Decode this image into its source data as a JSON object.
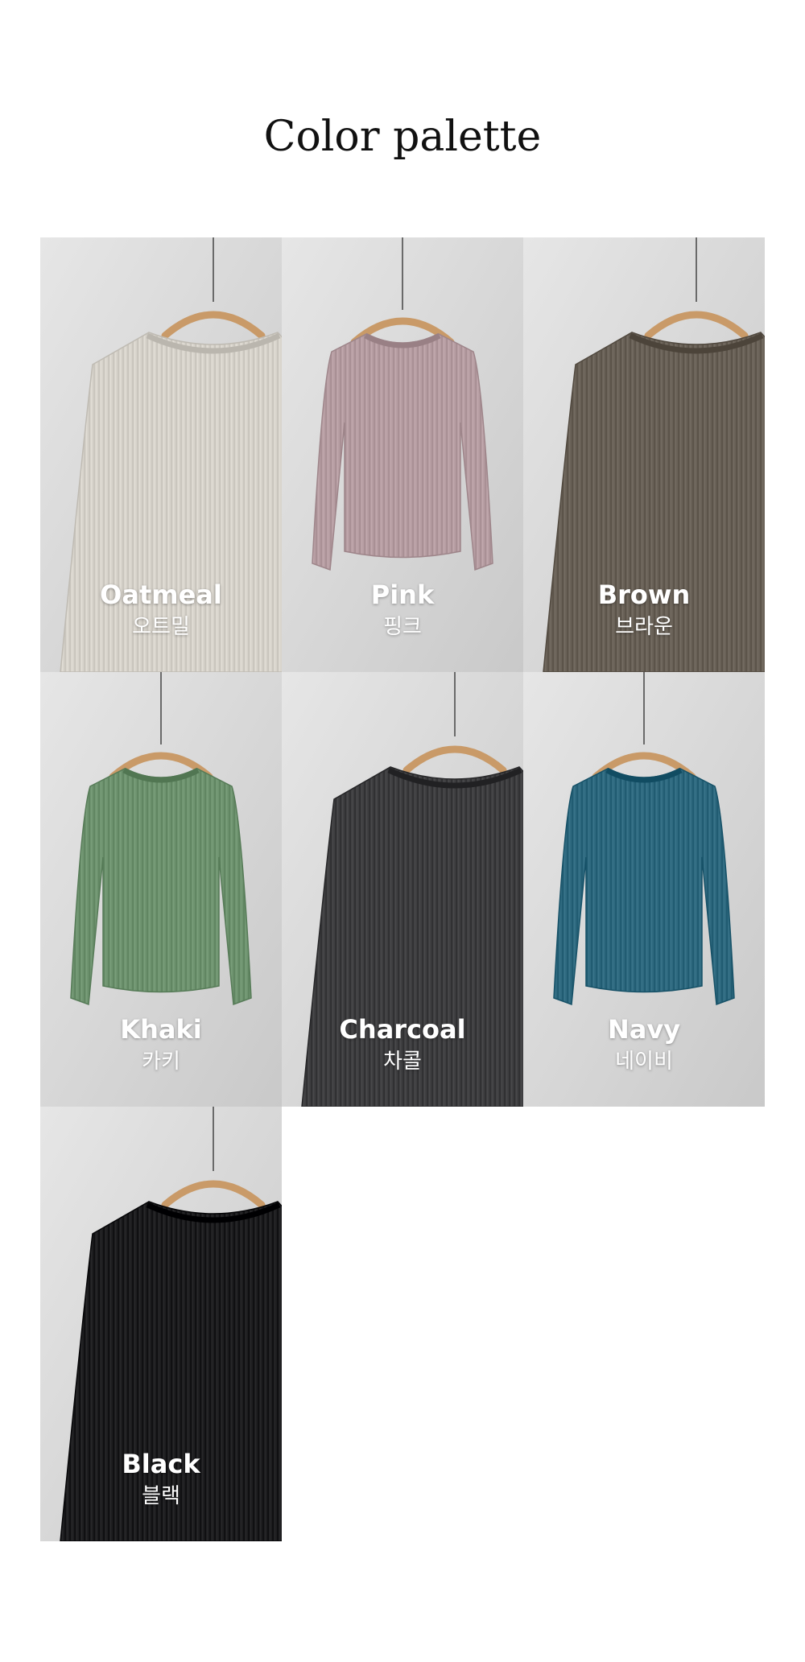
{
  "header": {
    "title": "Color palette"
  },
  "swatches": [
    {
      "name": "Oatmeal",
      "korean": "오트밀",
      "sweater_color": "#d8d4cc",
      "variant": "closeup"
    },
    {
      "name": "Pink",
      "korean": "핑크",
      "sweater_color": "#b79ea3",
      "variant": "full"
    },
    {
      "name": "Brown",
      "korean": "브라운",
      "sweater_color": "#6a6258",
      "variant": "closeup"
    },
    {
      "name": "Khaki",
      "korean": "카키",
      "sweater_color": "#6f9470",
      "variant": "full"
    },
    {
      "name": "Charcoal",
      "korean": "차콜",
      "sweater_color": "#3f3f41",
      "variant": "closeup"
    },
    {
      "name": "Navy",
      "korean": "네이비",
      "sweater_color": "#2f6a80",
      "variant": "full"
    },
    {
      "name": "Black",
      "korean": "블랙",
      "sweater_color": "#1e1e20",
      "variant": "closeup"
    }
  ]
}
